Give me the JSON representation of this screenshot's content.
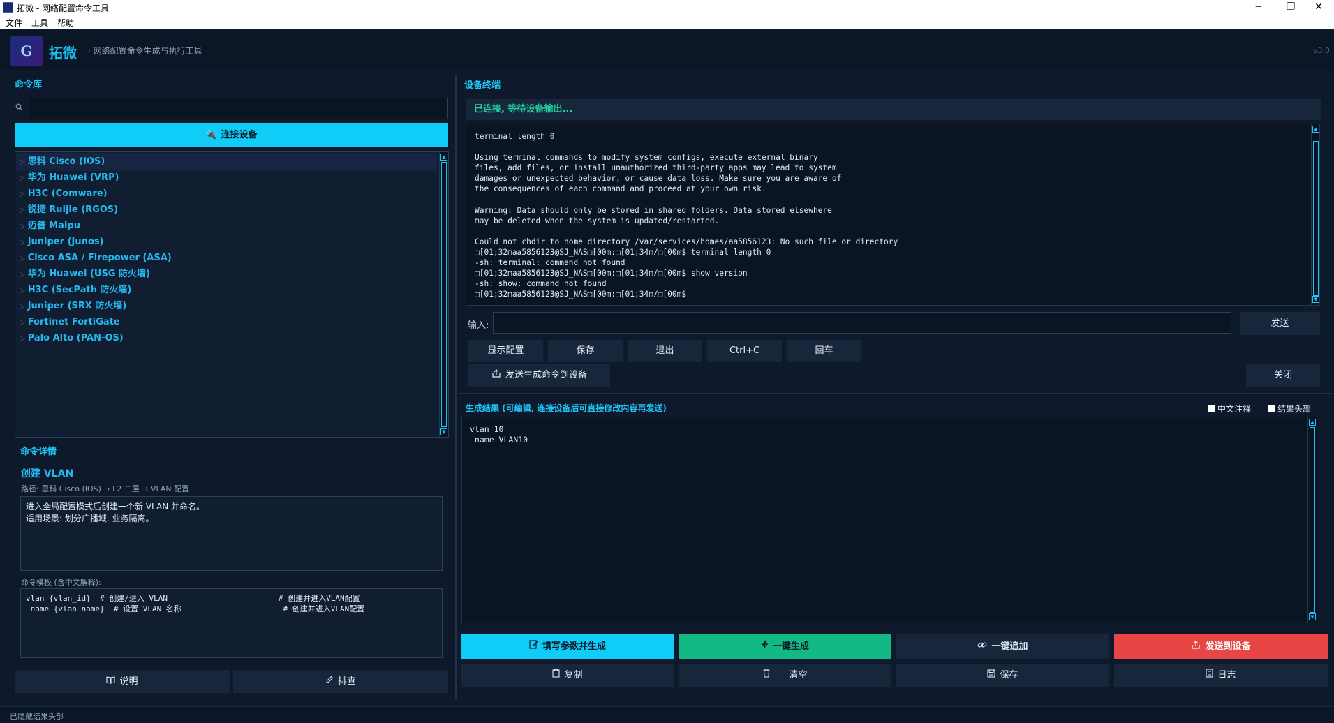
{
  "window": {
    "title": "拓微 - 网络配置命令工具",
    "minimize": "─",
    "maximize": "❐",
    "close": "✕"
  },
  "menu": [
    "文件",
    "工具",
    "帮助"
  ],
  "header": {
    "logo_text": "G",
    "brand": "拓微",
    "subtitle": "· 网络配置命令生成与执行工具",
    "version": "v3.0"
  },
  "left": {
    "library_title": "命令库",
    "search": {
      "value": "",
      "placeholder": ""
    },
    "connect_label": "连接设备",
    "vendors": [
      "思科 Cisco (IOS)",
      "华为 Huawei (VRP)",
      "H3C (Comware)",
      "锐捷 Ruijie (RGOS)",
      "迈普 Maipu",
      "Juniper (Junos)",
      "Cisco ASA / Firepower (ASA)",
      "华为 Huawei (USG 防火墙)",
      "H3C (SecPath 防火墙)",
      "Juniper (SRX 防火墙)",
      "Fortinet FortiGate",
      "Palo Alto (PAN-OS)"
    ],
    "detail_section": "命令详情",
    "detail_title": "创建 VLAN",
    "detail_path": "路径: 思科 Cisco (IOS) → L2 二层 → VLAN 配置",
    "detail_desc": "进入全局配置模式后创建一个新 VLAN 并命名。\n适用场景: 划分广播域, 业务隔离。",
    "template_label": "命令模板 (含中文解释):",
    "template": "vlan {vlan_id}  # 创建/进入 VLAN                        # 创建并进入VLAN配置\n name {vlan_name}  # 设置 VLAN 名称                      # 创建并进入VLAN配置",
    "explain_label": "说明",
    "troubleshoot_label": "排查"
  },
  "terminal": {
    "title": "设备终端",
    "status": "已连接, 等待设备输出...",
    "output": "terminal length 0\n\nUsing terminal commands to modify system configs, execute external binary\nfiles, add files, or install unauthorized third-party apps may lead to system\ndamages or unexpected behavior, or cause data loss. Make sure you are aware of\nthe consequences of each command and proceed at your own risk.\n\nWarning: Data should only be stored in shared folders. Data stored elsewhere\nmay be deleted when the system is updated/restarted.\n\nCould not chdir to home directory /var/services/homes/aa5856123: No such file or directory\n□[01;32maa5856123@SJ_NAS□[00m:□[01;34m/□[00m$ terminal length 0\n-sh: terminal: command not found\n□[01;32maa5856123@SJ_NAS□[00m:□[01;34m/□[00m$ show version\n-sh: show: command not found\n□[01;32maa5856123@SJ_NAS□[00m:□[01;34m/□[00m$",
    "input_label": "输入:",
    "input_value": "",
    "send": "发送",
    "quick": [
      "显示配置",
      "保存",
      "退出",
      "Ctrl+C",
      "回车"
    ],
    "send_generated": "发送生成命令到设备",
    "close": "关闭"
  },
  "result": {
    "label": "生成结果  (可编辑, 连接设备后可直接修改内容再发送)",
    "chk_cn": "中文注释",
    "chk_header": "结果头部",
    "text": "vlan 10\n name VLAN10",
    "fill_generate": "填写参数并生成",
    "one_click": "一键生成",
    "one_click_append": "一键追加",
    "send_device": "发送到设备",
    "copy": "复制",
    "clear": "清空",
    "save": "保存",
    "log": "日志"
  },
  "footer": {
    "status": "已隐藏结果头部"
  },
  "colors": {
    "accent": "#0fcdf6",
    "green": "#13b985",
    "red": "#e84545",
    "bg": "#0e1a2b"
  }
}
